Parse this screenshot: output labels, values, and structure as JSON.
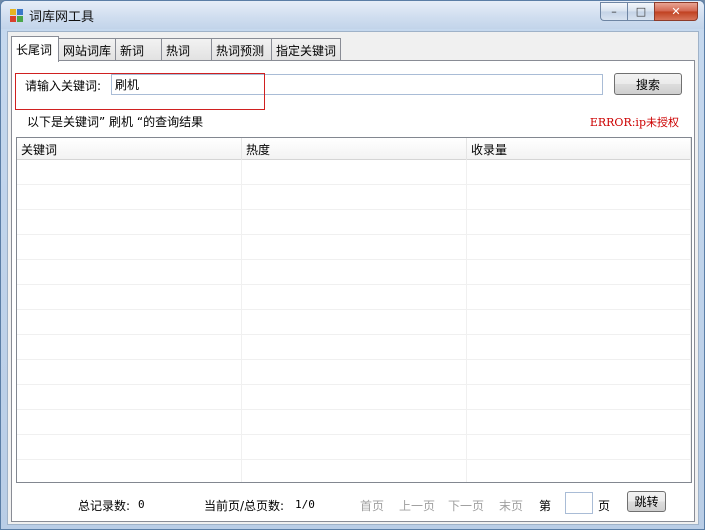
{
  "window": {
    "title": "词库网工具",
    "caption": {
      "minimize": "–",
      "maximize": "□",
      "close": "✕"
    }
  },
  "tabs": [
    "长尾词",
    "网站词库",
    "新词",
    "热词",
    "热词预测",
    "指定关键词"
  ],
  "search": {
    "label": "请输入关键词:",
    "value": "刷机",
    "button": "搜索"
  },
  "result_label": "以下是关键词” 刷机 “的查询结果",
  "error_label": "ERROR:ip未授权",
  "grid": {
    "columns": [
      "关键词",
      "热度",
      "收录量"
    ],
    "rows": []
  },
  "footer": {
    "total_label": "总记录数:",
    "total_value": "0",
    "page_label": "当前页/总页数:",
    "page_value": "1/0",
    "first": "首页",
    "prev": "上一页",
    "next": "下一页",
    "last": "末页",
    "di": "第",
    "ye": "页",
    "jump": "跳转",
    "page_input": ""
  }
}
